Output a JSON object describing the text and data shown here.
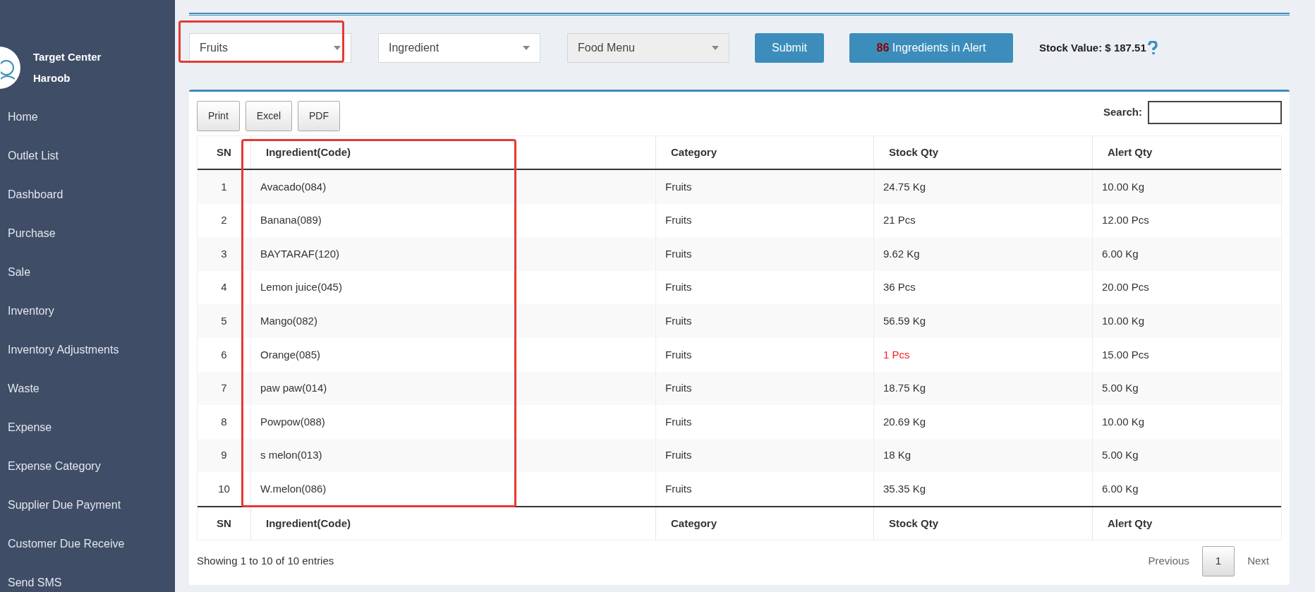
{
  "sidebar": {
    "profile": {
      "line1": "Target Center",
      "line2": "Haroob"
    },
    "items": [
      {
        "label": "Home"
      },
      {
        "label": "Outlet List"
      },
      {
        "label": "Dashboard"
      },
      {
        "label": "Purchase"
      },
      {
        "label": "Sale"
      },
      {
        "label": "Inventory"
      },
      {
        "label": "Inventory Adjustments"
      },
      {
        "label": "Waste"
      },
      {
        "label": "Expense"
      },
      {
        "label": "Expense Category"
      },
      {
        "label": "Supplier Due Payment"
      },
      {
        "label": "Customer Due Receive"
      },
      {
        "label": "Send SMS"
      }
    ]
  },
  "filters": [
    {
      "value": "Fruits",
      "disabled": false,
      "highlighted": true
    },
    {
      "value": "Ingredient",
      "disabled": false,
      "highlighted": false
    },
    {
      "value": "Food Menu",
      "disabled": true,
      "highlighted": false
    }
  ],
  "submit": "Submit",
  "alert_button": {
    "count": "86",
    "label": "Ingredients in Alert"
  },
  "stock_value": "Stock Value: $ 187.51",
  "export_buttons": [
    "Print",
    "Excel",
    "PDF"
  ],
  "search": {
    "label": "Search:"
  },
  "table": {
    "columns": [
      "SN",
      "Ingredient(Code)",
      "Category",
      "Stock Qty",
      "Alert Qty"
    ],
    "ingredient_column_highlighted": true,
    "rows": [
      {
        "sn": "1",
        "ingredient": "Avacado(084)",
        "category": "Fruits",
        "stock": "24.75 Kg",
        "alert": "10.00 Kg",
        "low": false
      },
      {
        "sn": "2",
        "ingredient": "Banana(089)",
        "category": "Fruits",
        "stock": "21 Pcs",
        "alert": "12.00 Pcs",
        "low": false
      },
      {
        "sn": "3",
        "ingredient": "BAYTARAF(120)",
        "category": "Fruits",
        "stock": "9.62 Kg",
        "alert": "6.00 Kg",
        "low": false
      },
      {
        "sn": "4",
        "ingredient": "Lemon juice(045)",
        "category": "Fruits",
        "stock": "36 Pcs",
        "alert": "20.00 Pcs",
        "low": false
      },
      {
        "sn": "5",
        "ingredient": "Mango(082)",
        "category": "Fruits",
        "stock": "56.59 Kg",
        "alert": "10.00 Kg",
        "low": false
      },
      {
        "sn": "6",
        "ingredient": "Orange(085)",
        "category": "Fruits",
        "stock": "1 Pcs",
        "alert": "15.00 Pcs",
        "low": true
      },
      {
        "sn": "7",
        "ingredient": "paw paw(014)",
        "category": "Fruits",
        "stock": "18.75 Kg",
        "alert": "5.00 Kg",
        "low": false
      },
      {
        "sn": "8",
        "ingredient": "Powpow(088)",
        "category": "Fruits",
        "stock": "20.69 Kg",
        "alert": "10.00 Kg",
        "low": false
      },
      {
        "sn": "9",
        "ingredient": "s melon(013)",
        "category": "Fruits",
        "stock": "18 Kg",
        "alert": "5.00 Kg",
        "low": false
      },
      {
        "sn": "10",
        "ingredient": "W.melon(086)",
        "category": "Fruits",
        "stock": "35.35 Kg",
        "alert": "6.00 Kg",
        "low": false
      }
    ],
    "footer_columns": [
      "SN",
      "Ingredient(Code)",
      "Category",
      "Stock Qty",
      "Alert Qty"
    ]
  },
  "info": "Showing 1 to 10 of 10 entries",
  "pagination": [
    {
      "label": "Previous",
      "selected": false
    },
    {
      "label": "1",
      "selected": true
    },
    {
      "label": "Next",
      "selected": false
    }
  ]
}
